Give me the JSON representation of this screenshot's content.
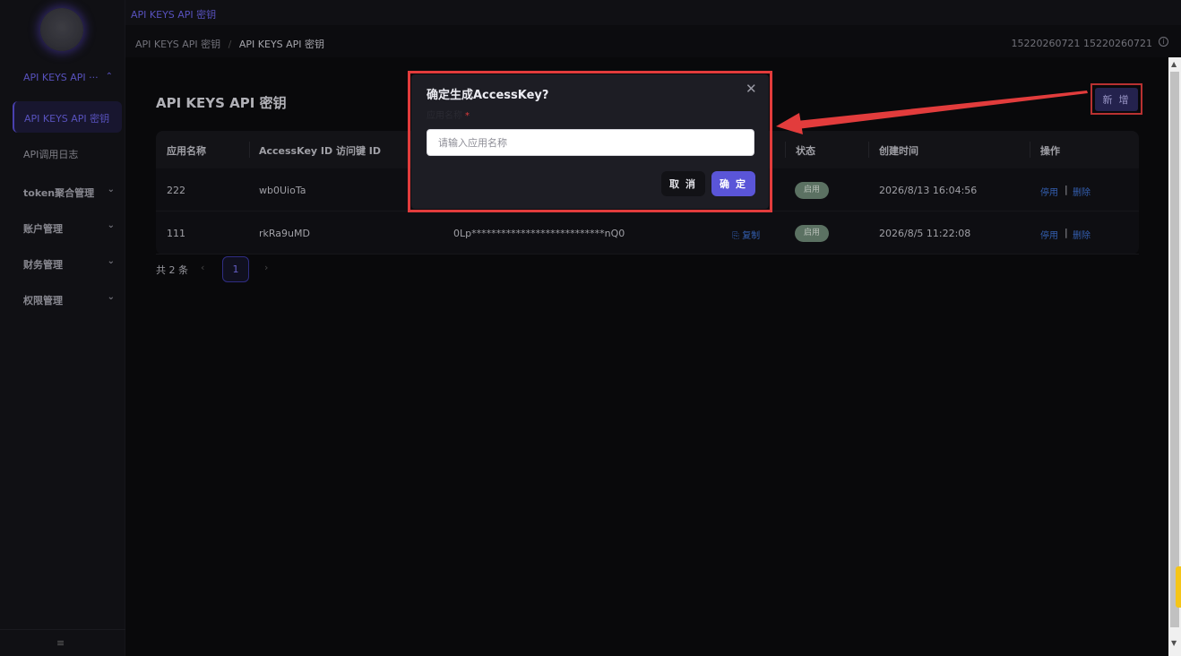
{
  "top_tab": "API KEYS  API 密钥",
  "breadcrumb": {
    "parent": "API KEYS  API 密钥",
    "separator": "/",
    "current": "API KEYS  API 密钥"
  },
  "user": {
    "text": "15220260721  15220260721",
    "info_icon": "info-icon"
  },
  "sidebar": {
    "group_title": "API KEYS  API ···",
    "active_item": "API KEYS  API 密钥",
    "items": [
      {
        "label": "API调用日志"
      },
      {
        "label": "token聚合管理"
      },
      {
        "label": "账户管理"
      },
      {
        "label": "财务管理"
      },
      {
        "label": "权限管理"
      }
    ],
    "collapse_icon": "≡",
    "chevron_up": "⌃",
    "chevron_down": "⌄"
  },
  "page": {
    "title": "API KEYS  API 密钥",
    "add_button": "新 增"
  },
  "table": {
    "headers": {
      "app_name": "应用名称",
      "access_key_id": "AccessKey ID  访问键 ID",
      "status": "状态",
      "created_at": "创建时间",
      "actions": "操作"
    },
    "rows": [
      {
        "app_name": "222",
        "access_key_id": "wb0UioTa",
        "secret": "",
        "status": "启用",
        "created_at": "2026/8/13 16:04:56",
        "disable": "停用",
        "delete": "删除"
      },
      {
        "app_name": "111",
        "access_key_id": "rkRa9uMD",
        "secret": "0Lp***************************nQ0",
        "copy": "复制",
        "status": "启用",
        "created_at": "2026/8/5 11:22:08",
        "disable": "停用",
        "delete": "删除"
      }
    ]
  },
  "pagination": {
    "total": "共 2 条",
    "prev": "‹",
    "current": "1",
    "next": "›"
  },
  "modal": {
    "title": "确定生成AccessKey?",
    "field_label": "应用名称",
    "required_mark": "*",
    "input_placeholder": "请输入应用名称",
    "cancel": "取 消",
    "confirm": "确 定",
    "close": "✕"
  },
  "colors": {
    "accent": "#5a55d8",
    "highlight": "#e23c3c",
    "link": "#3f73d6",
    "badge": "#6f8a78"
  }
}
